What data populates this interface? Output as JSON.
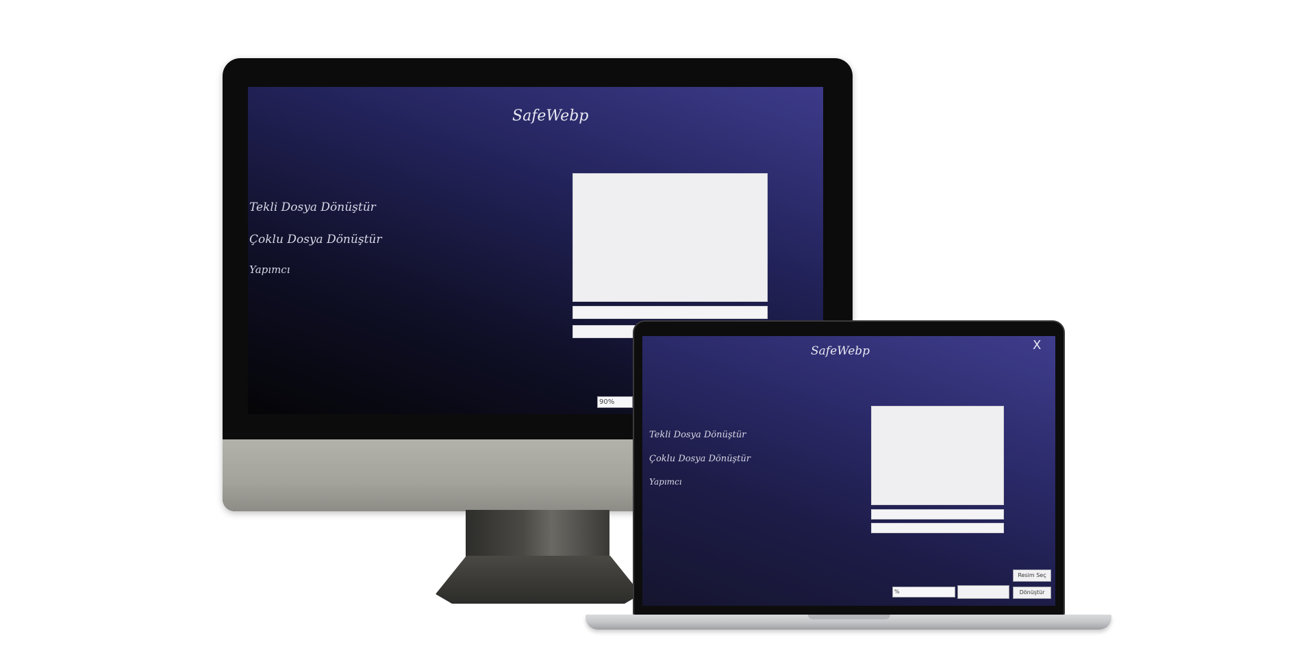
{
  "app": {
    "title": "SafeWebp",
    "close_glyph": "X",
    "menu": [
      {
        "label": "Tekli Dosya Dönüştür"
      },
      {
        "label": "Çoklu Dosya Dönüştür"
      },
      {
        "label": "Yapımcı"
      }
    ],
    "quality_value": "90%",
    "laptop_quality_value": "%",
    "select_button_label": "Resim Seç",
    "convert_button_label": "Dönüştür"
  },
  "colors": {
    "background": "#ffffff",
    "app_gradient_top": "#3d3b8a",
    "app_gradient_bottom": "#050507",
    "text": "#e8e8f2"
  }
}
